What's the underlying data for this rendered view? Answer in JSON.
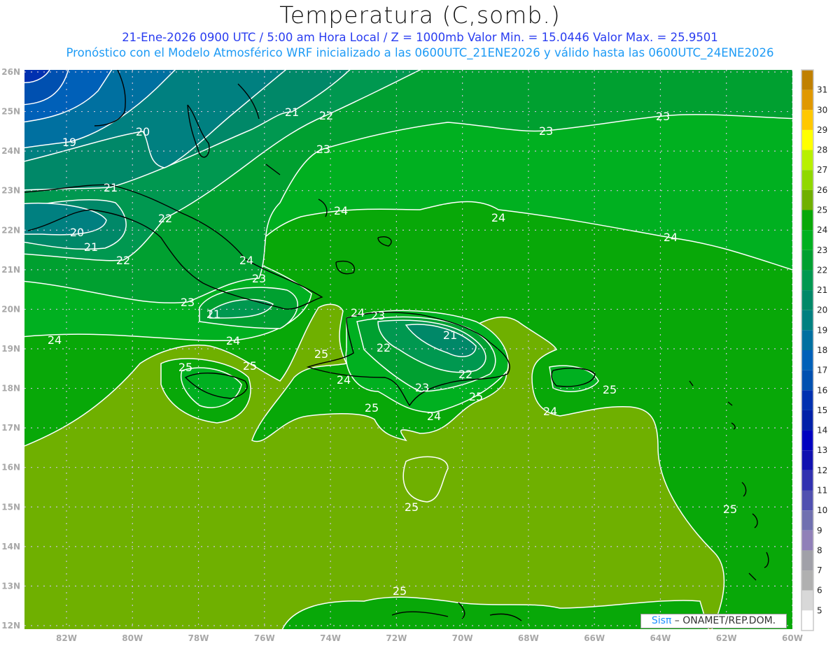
{
  "header": {
    "title": "Temperatura (C,somb.)",
    "subtitle_line1": "21-Ene-2026  0900 UTC / 5:00 am Hora Local / Z = 1000mb    Valor Min. = 15.0446   Valor Max. = 25.9501",
    "subtitle_line2": "Pronóstico con el Modelo Atmosférico WRF inicializado a las 0600UTC_21ENE2026 y válido hasta las  0600UTC_24ENE2026"
  },
  "map": {
    "lat_labels": [
      "26N",
      "25N",
      "24N",
      "23N",
      "22N",
      "21N",
      "20N",
      "19N",
      "18N",
      "17N",
      "16N",
      "15N",
      "14N",
      "13N",
      "12N"
    ],
    "lon_labels": [
      "82W",
      "80W",
      "78W",
      "76W",
      "74W",
      "72W",
      "70W",
      "68W",
      "66W",
      "64W",
      "62W",
      "60W"
    ],
    "contour_labels": [
      "19",
      "20",
      "21",
      "22",
      "23",
      "23",
      "23",
      "21",
      "22",
      "20",
      "21",
      "22",
      "24",
      "24",
      "24",
      "24",
      "23",
      "23",
      "21",
      "24",
      "24",
      "24",
      "23",
      "21",
      "22",
      "22",
      "25",
      "24",
      "23",
      "25",
      "25",
      "25",
      "25",
      "24",
      "24",
      "25",
      "25",
      "25",
      "25"
    ],
    "colors": {
      "c25_26": "#6fb000",
      "c24_25": "#08a808",
      "c23_24": "#00b020",
      "c22_23": "#00a030",
      "c21_22": "#009850",
      "c20_21": "#008868",
      "c19_20": "#008080",
      "c18_19": "#0070a0",
      "c17_18": "#0060b8",
      "c16_17": "#0050b0",
      "c15_16": "#0030b0",
      "contour": "#ffffff",
      "coast": "#000000"
    }
  },
  "colorbar": {
    "labels": [
      "31",
      "30",
      "29",
      "28",
      "27",
      "26",
      "25",
      "24",
      "23",
      "22",
      "21",
      "20",
      "19",
      "18",
      "17",
      "16",
      "15",
      "14",
      "13",
      "12",
      "11",
      "10",
      "9",
      "8",
      "7",
      "6",
      "5"
    ],
    "colors": [
      "#c08000",
      "#e09800",
      "#ffc800",
      "#ffff00",
      "#b8f000",
      "#90d800",
      "#70b000",
      "#08a808",
      "#00b020",
      "#00a030",
      "#009850",
      "#008868",
      "#008080",
      "#0070a0",
      "#0060b8",
      "#0050b0",
      "#0030b0",
      "#0020a8",
      "#0000c0",
      "#1010b0",
      "#3030b0",
      "#5050b0",
      "#7070b0",
      "#9080b8",
      "#a0a0a8",
      "#b0b0b0",
      "#d8d8d8",
      "#ffffff"
    ]
  },
  "credit": {
    "brand": "Sisπ",
    "text": " –  ONAMET/REP.DOM."
  }
}
